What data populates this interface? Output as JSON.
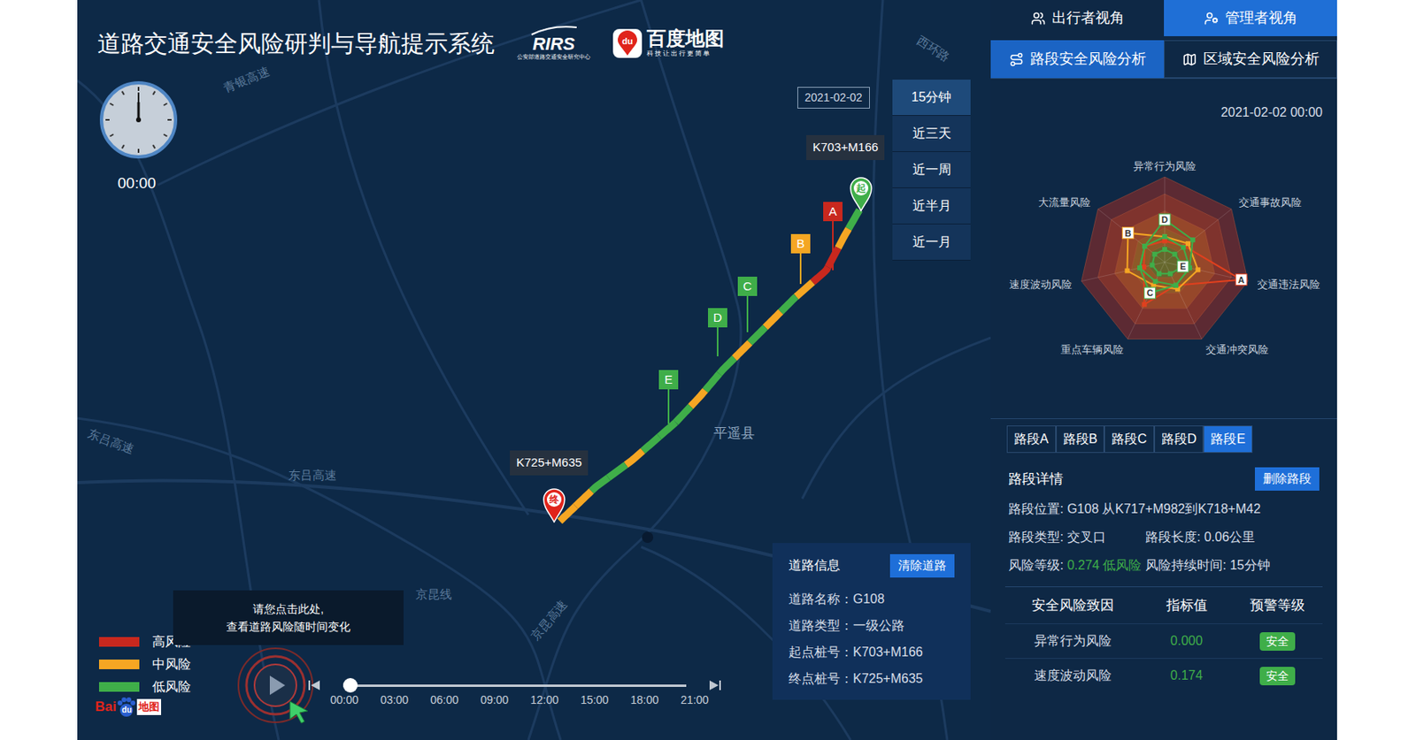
{
  "header": {
    "title": "道路交通安全风险研判与导航提示系统",
    "rirs_logo": {
      "text": "RIRS",
      "subtitle": "公安部道路交通安全研究中心"
    },
    "baidu_logo": {
      "badge": "du",
      "name": "百度地图",
      "slogan": "科技让出行更简单"
    }
  },
  "clock": {
    "time": "00:00"
  },
  "date": "2021-02-02",
  "time_ranges": [
    {
      "label": "15分钟",
      "selected": true
    },
    {
      "label": "近三天",
      "selected": false
    },
    {
      "label": "近一周",
      "selected": false
    },
    {
      "label": "近半月",
      "selected": false
    },
    {
      "label": "近一月",
      "selected": false
    }
  ],
  "route": {
    "start_label": "K703+M166",
    "end_label": "K725+M635",
    "start_pin": "起",
    "end_pin": "终",
    "segments": [
      "low",
      "medium",
      "high",
      "high",
      "medium",
      "low",
      "medium",
      "low",
      "medium",
      "low",
      "low",
      "medium",
      "low",
      "low",
      "low",
      "medium",
      "low",
      "low",
      "medium",
      "medium"
    ]
  },
  "markers": [
    {
      "label": "A",
      "color": "#c8281e"
    },
    {
      "label": "B",
      "color": "#f5a623"
    },
    {
      "label": "C",
      "color": "#3fae49"
    },
    {
      "label": "D",
      "color": "#3fae49"
    },
    {
      "label": "E",
      "color": "#3fae49"
    }
  ],
  "map_labels": [
    "青银高速",
    "西环路",
    "东吕高速",
    "东吕高速",
    "平遥县",
    "京昆线",
    "京昆高速"
  ],
  "legend": [
    {
      "label": "高风险",
      "level": "high",
      "color": "#c8281e"
    },
    {
      "label": "中风险",
      "level": "medium",
      "color": "#f5a623"
    },
    {
      "label": "低风险",
      "level": "low",
      "color": "#3fae49"
    }
  ],
  "tooltip": [
    "请您点击此处,",
    "查看道路风险随时间变化"
  ],
  "timeline": {
    "ticks": [
      "00:00",
      "03:00",
      "06:00",
      "09:00",
      "12:00",
      "15:00",
      "18:00",
      "21:00"
    ],
    "level": 0
  },
  "road_info": {
    "title": "道路信息",
    "button": "清除道路",
    "rows": [
      {
        "label": "道路名称：",
        "value": "G108"
      },
      {
        "label": "道路类型：",
        "value": "一级公路"
      },
      {
        "label": "起点桩号：",
        "value": "K703+M166"
      },
      {
        "label": "终点桩号：",
        "value": "K725+M635"
      }
    ]
  },
  "baidu_watermark": {
    "left": "Bai",
    "middle": "du",
    "right": "地图"
  },
  "panel": {
    "view_tabs": [
      {
        "label": "出行者视角",
        "selected": false
      },
      {
        "label": "管理者视角",
        "selected": true
      }
    ],
    "analysis_tabs": [
      {
        "label": "路段安全风险分析",
        "selected": true
      },
      {
        "label": "区域安全风险分析",
        "selected": false
      }
    ],
    "timestamp": "2021-02-02 00:00",
    "radar": {
      "axes": [
        "异常行为风险",
        "交通事故风险",
        "交通违法风险",
        "交通冲突风险",
        "重点车辆风险",
        "速度波动风险",
        "大流量风险"
      ],
      "series": [
        {
          "name": "A",
          "color": "#e0401e",
          "values": [
            0.25,
            0.3,
            0.92,
            0.3,
            0.55,
            0.25,
            0.3
          ]
        },
        {
          "name": "B",
          "color": "#f5a623",
          "values": [
            0.3,
            0.35,
            0.4,
            0.35,
            0.3,
            0.45,
            0.55
          ]
        },
        {
          "name": "C",
          "color": "#3fae49",
          "values": [
            0.3,
            0.28,
            0.3,
            0.3,
            0.4,
            0.3,
            0.3
          ]
        },
        {
          "name": "D",
          "color": "#3fae49",
          "values": [
            0.5,
            0.42,
            0.3,
            0.3,
            0.25,
            0.3,
            0.3
          ]
        },
        {
          "name": "E",
          "color": "#3fae49",
          "values": [
            0.15,
            0.15,
            0.22,
            0.15,
            0.15,
            0.15,
            0.15
          ]
        }
      ]
    },
    "segment_tabs": [
      {
        "label": "路段A",
        "selected": false
      },
      {
        "label": "路段B",
        "selected": false
      },
      {
        "label": "路段C",
        "selected": false
      },
      {
        "label": "路段D",
        "selected": false
      },
      {
        "label": "路段E",
        "selected": true
      }
    ],
    "details": {
      "title": "路段详情",
      "button": "删除路段",
      "location": {
        "label": "路段位置:",
        "value": "G108 从K717+M982到K718+M42"
      },
      "type": {
        "label": "路段类型:",
        "value": "交叉口"
      },
      "length": {
        "label": "路段长度:",
        "value": "0.06公里"
      },
      "risk": {
        "label": "风险等级:",
        "value": "0.274 低风险",
        "color": "#3fae49"
      },
      "duration": {
        "label": "风险持续时间:",
        "value": "15分钟"
      }
    },
    "table": {
      "columns": [
        "安全风险致因",
        "指标值",
        "预警等级"
      ],
      "rows": [
        {
          "cause": "异常行为风险",
          "value": "0.000",
          "status": "安全",
          "color": "#3fae49"
        },
        {
          "cause": "速度波动风险",
          "value": "0.174",
          "status": "安全",
          "color": "#3fae49"
        }
      ]
    }
  }
}
